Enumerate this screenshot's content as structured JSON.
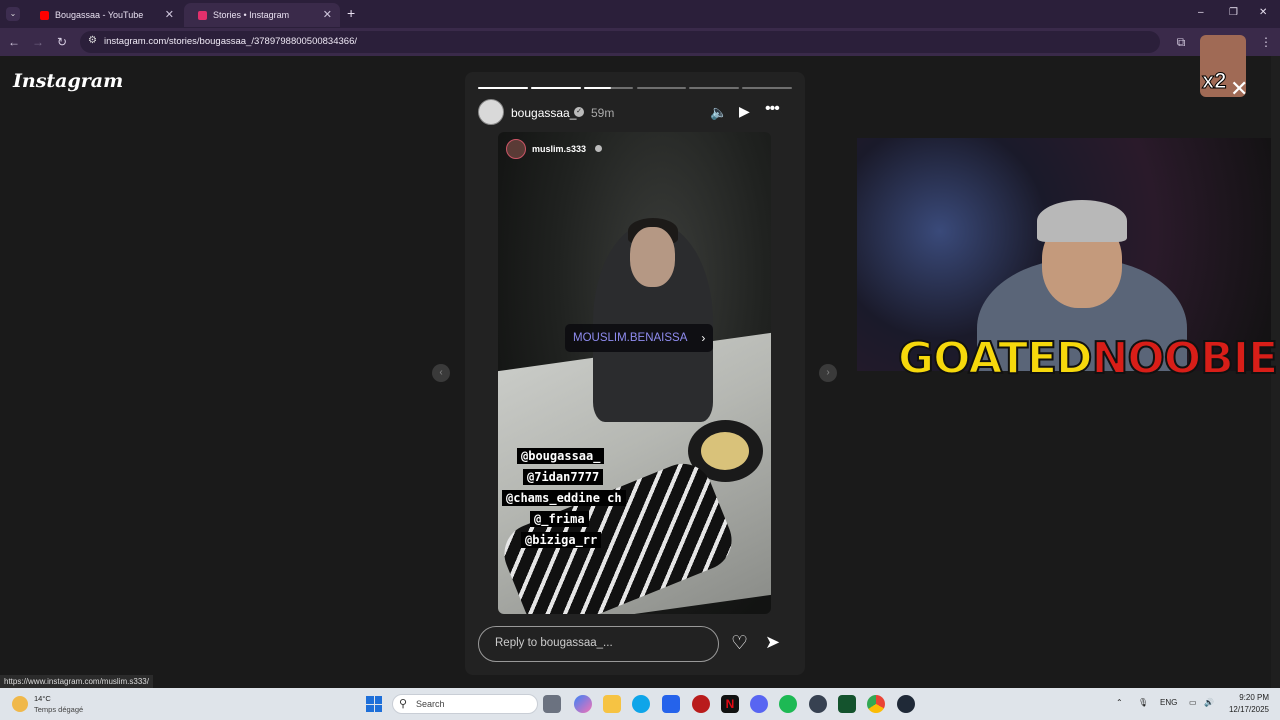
{
  "browser": {
    "tabs": [
      {
        "label": "Bougassaa - YouTube",
        "favicon_color": "#ff0000",
        "active": false
      },
      {
        "label": "Stories • Instagram",
        "favicon_color": "#e1306c",
        "active": true
      }
    ],
    "url": "instagram.com/stories/bougassaa_/3789798800500834366/",
    "new_tab_glyph": "+",
    "window_controls": [
      "–",
      "❐",
      "✕"
    ]
  },
  "instagram": {
    "logo": "Instagram",
    "story": {
      "username": "bougassaa_",
      "time_ago": "59m",
      "progress_segments": [
        1,
        1,
        0.55,
        0,
        0,
        0
      ],
      "shared_from": "muslim.s333",
      "mention_sticker": "MOUSLIM.BENAISSA",
      "tags": [
        "@bougassaa_",
        "@7idan7777",
        "@chams_eddine ch",
        "@_frima",
        "@biziga_rr"
      ],
      "reply_placeholder": "Reply to bougassaa_..."
    }
  },
  "overlay": {
    "goated": "GOATED",
    "noobie": "NOOBIE",
    "multiplier": "x2"
  },
  "status_url": "https://www.instagram.com/muslim.s333/",
  "taskbar": {
    "weather_temp": "14°C",
    "weather_desc": "Temps dégagé",
    "search_label": "Search",
    "language": "ENG",
    "time": "9:20 PM",
    "date": "12/17/2025"
  }
}
